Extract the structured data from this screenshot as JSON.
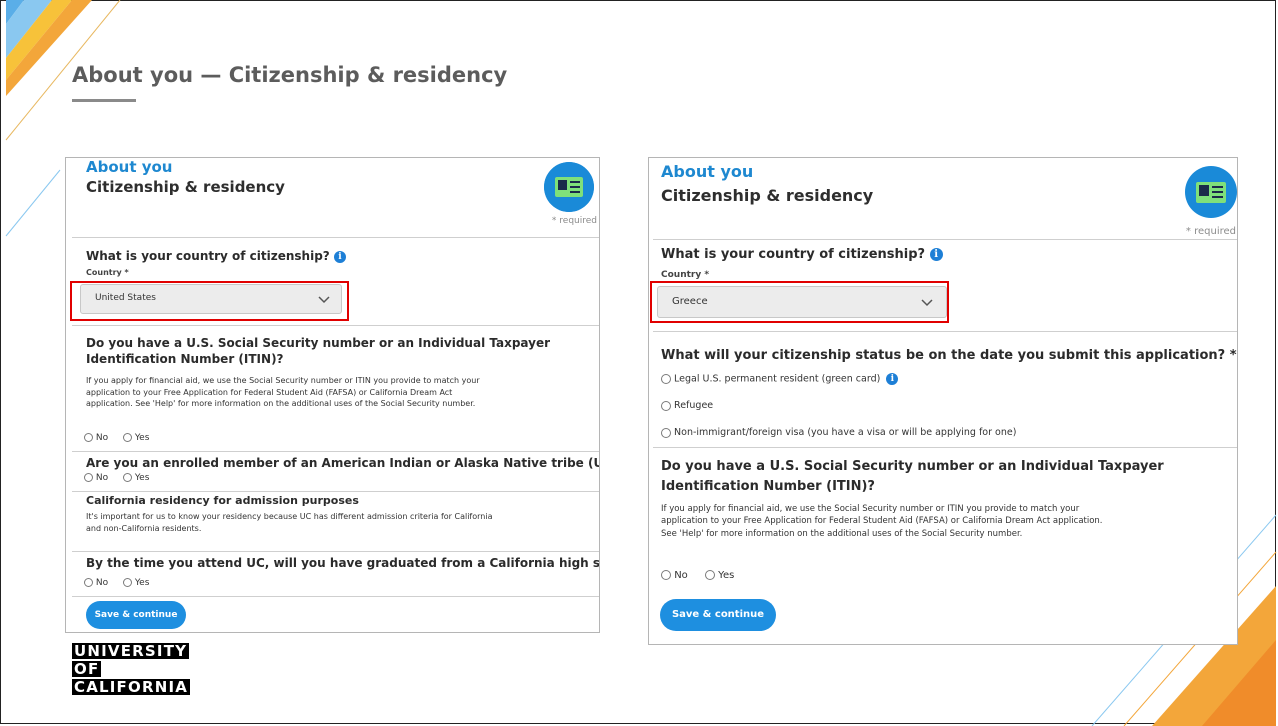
{
  "slide": {
    "title": "About you — Citizenship & residency"
  },
  "panel_left": {
    "section": "About you",
    "subtitle": "Citizenship & residency",
    "required_note": "* required",
    "q_country": "What is your country of citizenship?",
    "country_label": "Country *",
    "country_value": "United States",
    "q_ssn": "Do you have a U.S. Social Security number or an Individual Taxpayer Identification Number (ITIN)?",
    "ssn_help": "If you apply for financial aid, we use the Social Security number or ITIN you provide to match your application to your Free Application for Federal Student Aid (FAFSA) or California Dream Act application. See 'Help' for more information on the additional uses of the Social Security number.",
    "q_tribe": "Are you an enrolled member of an American Indian or Alaska Native tribe (U.S.)?",
    "residency_heading": "California residency for admission purposes",
    "residency_help": "It's important for us to know your residency because UC has different admission criteria for California and non-California residents.",
    "q_graduated": "By the time you attend UC, will you have graduated from a California high school?*",
    "opt_no": "No",
    "opt_yes": "Yes",
    "button": "Save & continue"
  },
  "panel_right": {
    "section": "About you",
    "subtitle": "Citizenship & residency",
    "required_note": "* required",
    "q_country": "What is your country of citizenship?",
    "country_label": "Country *",
    "country_value": "Greece",
    "q_status": "What will your citizenship status be on the date you submit this application? *",
    "status_options": [
      "Legal U.S. permanent resident (green card)",
      "Refugee",
      "Non-immigrant/foreign visa (you have a visa or will be applying for one)"
    ],
    "q_ssn": "Do you have a U.S. Social Security number or an Individual Taxpayer Identification Number (ITIN)?",
    "ssn_help": "If you apply for financial aid, we use the Social Security number or ITIN you provide to match your application to your Free Application for Federal Student Aid (FAFSA) or California Dream Act application. See 'Help' for more information on the additional uses of the Social Security number.",
    "opt_no": "No",
    "opt_yes": "Yes",
    "button": "Save & continue"
  },
  "logo": {
    "line1": "UNIVERSITY",
    "line2": "OF",
    "line3": "CALIFORNIA"
  },
  "colors": {
    "accent_blue": "#1e88d0",
    "button_blue": "#1e8fe0",
    "highlight_red": "#e10000",
    "title_gray": "#5c5c5c"
  },
  "icons": {
    "info": "info-icon",
    "chevron": "chevron-down-icon",
    "id_card": "id-card-icon",
    "radio": "radio-icon"
  }
}
